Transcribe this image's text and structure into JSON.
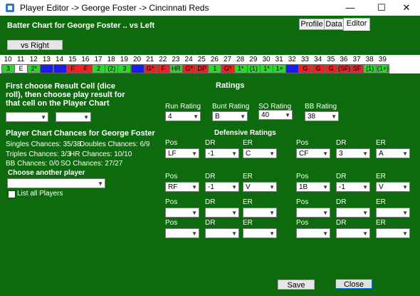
{
  "window": {
    "title": "Player Editor -> George Foster -> Cincinnati Reds",
    "min": "—",
    "max": "☐",
    "close": "✕"
  },
  "header": {
    "chart_title": "Batter Chart for George Foster .. vs Left",
    "vs_button": "vs Right"
  },
  "tabs": [
    {
      "label": "Profile"
    },
    {
      "label": "Data"
    },
    {
      "label": "Editor"
    }
  ],
  "grid": {
    "numbers": [
      "10",
      "11",
      "12",
      "13",
      "14",
      "15",
      "16",
      "17",
      "18",
      "19",
      "20",
      "21",
      "22",
      "23",
      "24",
      "25",
      "26",
      "27",
      "28",
      "29",
      "30",
      "31",
      "32",
      "33",
      "34",
      "35",
      "36",
      "37",
      "38",
      "39"
    ],
    "cells": [
      {
        "text": "3",
        "color": "green"
      },
      {
        "text": "E",
        "color": "white"
      },
      {
        "text": "2*",
        "color": "green"
      },
      {
        "text": "",
        "color": "blue"
      },
      {
        "text": "",
        "color": "blue"
      },
      {
        "text": "F",
        "color": "red"
      },
      {
        "text": "F",
        "color": "red"
      },
      {
        "text": "2",
        "color": "green"
      },
      {
        "text": "(2)",
        "color": "green"
      },
      {
        "text": "3",
        "color": "green"
      },
      {
        "text": "",
        "color": "blue"
      },
      {
        "text": "G*",
        "color": "red"
      },
      {
        "text": "F",
        "color": "red"
      },
      {
        "text": "HR",
        "color": "green"
      },
      {
        "text": "G*",
        "color": "red"
      },
      {
        "text": "DP",
        "color": "red"
      },
      {
        "text": "1",
        "color": "green"
      },
      {
        "text": "G*",
        "color": "red"
      },
      {
        "text": "1*",
        "color": "green"
      },
      {
        "text": "(1)",
        "color": "green"
      },
      {
        "text": "1*",
        "color": "green"
      },
      {
        "text": "1+",
        "color": "green"
      },
      {
        "text": "",
        "color": "blue"
      },
      {
        "text": "G",
        "color": "red"
      },
      {
        "text": "G",
        "color": "red"
      },
      {
        "text": "G",
        "color": "red"
      },
      {
        "text": "(SF)",
        "color": "red"
      },
      {
        "text": "SF",
        "color": "red"
      },
      {
        "text": "(1)",
        "color": "green"
      },
      {
        "text": "(1+)",
        "color": "green"
      }
    ]
  },
  "instructions": "First choose Result Cell (dice roll), then choose play result for that cell on the Player Chart",
  "chances": {
    "title": "Player Chart Chances for George Foster",
    "singles": "Singles Chances: 35/38",
    "doubles": "Doubles Chances: 6/9",
    "triples": "Triples Chances: 3/3",
    "hr": "HR Chances: 10/10",
    "bb": "BB Chances: 0/0",
    "so": "SO Chances: 27/27"
  },
  "choose_player": {
    "label": "Choose another player",
    "list_all": "List all Players"
  },
  "ratings": {
    "title": "Ratings",
    "run_label": "Run Rating",
    "run_value": "4",
    "bunt_label": "Bunt Rating",
    "bunt_value": "B",
    "so_label": "SO Rating",
    "so_value": "40",
    "bb_label": "BB Rating",
    "bb_value": "38"
  },
  "defense": {
    "title": "Defensive Ratings",
    "pos_label": "Pos",
    "dr_label": "DR",
    "er_label": "ER",
    "rows": [
      {
        "pos": "LF",
        "dr": "-1",
        "er": "C",
        "pos2": "CF",
        "dr2": "3",
        "er2": "A"
      },
      {
        "pos": "RF",
        "dr": "-1",
        "er": "V",
        "pos2": "1B",
        "dr2": "-1",
        "er2": "V"
      },
      {
        "pos": "",
        "dr": "",
        "er": "",
        "pos2": "",
        "dr2": "",
        "er2": ""
      },
      {
        "pos": "",
        "dr": "",
        "er": "",
        "pos2": "",
        "dr2": "",
        "er2": ""
      }
    ]
  },
  "footer": {
    "save": "Save",
    "close": "Close"
  }
}
